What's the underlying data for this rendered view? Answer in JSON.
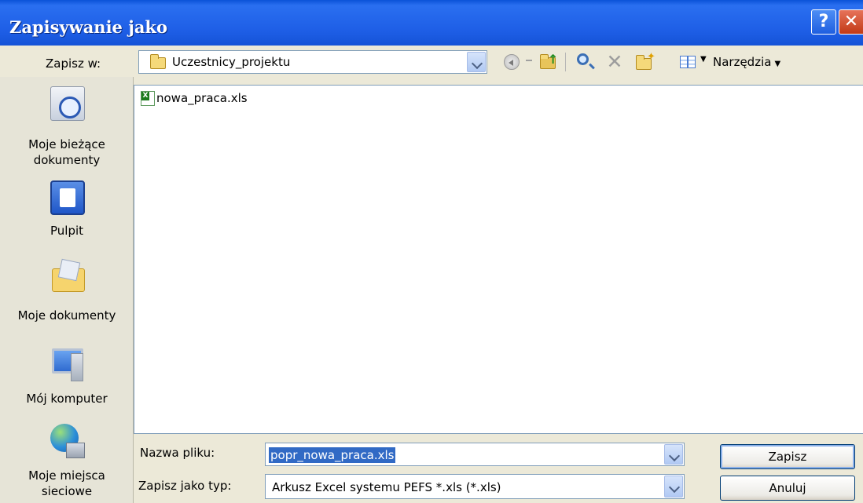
{
  "window": {
    "title": "Zapisywanie jako",
    "help_label": "?",
    "close_label": "✕"
  },
  "lookin": {
    "label": "Zapisz w:",
    "value": "Uczestnicy_projektu"
  },
  "toolbar": {
    "delete_glyph": "✕",
    "tools_label": "Narzędzia"
  },
  "places": [
    {
      "label_line1": "Moje bieżące",
      "label_line2": "dokumenty",
      "icon": "recent-documents-icon"
    },
    {
      "label_line1": "Pulpit",
      "label_line2": "",
      "icon": "desktop-icon"
    },
    {
      "label_line1": "Moje dokumenty",
      "label_line2": "",
      "icon": "my-documents-icon"
    },
    {
      "label_line1": "Mój komputer",
      "label_line2": "",
      "icon": "my-computer-icon"
    },
    {
      "label_line1": "Moje miejsca",
      "label_line2": "sieciowe",
      "icon": "network-places-icon"
    }
  ],
  "files": [
    {
      "name": "nowa_praca.xls",
      "icon": "excel-file-icon"
    }
  ],
  "filename": {
    "label": "Nazwa pliku:",
    "value": "popr_nowa_praca.xls"
  },
  "filetype": {
    "label": "Zapisz jako typ:",
    "value": "Arkusz Excel systemu PEFS *.xls (*.xls)"
  },
  "buttons": {
    "save": "Zapisz",
    "cancel": "Anuluj"
  }
}
